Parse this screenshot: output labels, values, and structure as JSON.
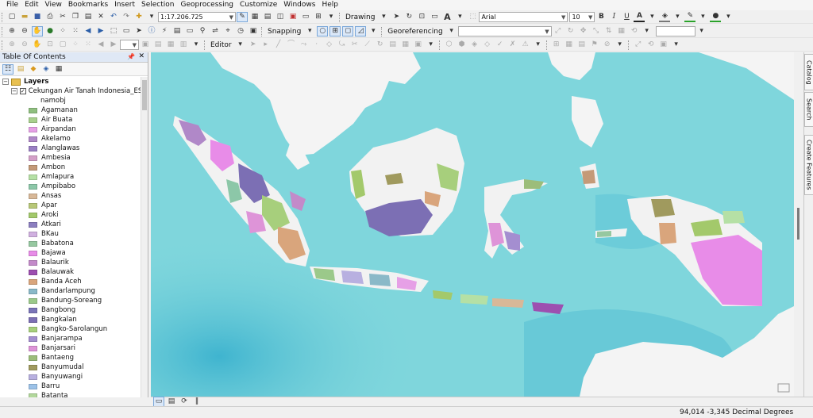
{
  "menubar": {
    "items": [
      "File",
      "Edit",
      "View",
      "Bookmarks",
      "Insert",
      "Selection",
      "Geoprocessing",
      "Customize",
      "Windows",
      "Help"
    ]
  },
  "toolbar": {
    "scale_value": "1:17.206.725",
    "drawing_label": "Drawing",
    "font_name": "Arial",
    "font_size": "10",
    "bold_label": "B",
    "italic_label": "I",
    "underline_label": "U",
    "text_tool_label": "A",
    "snapping_label": "Snapping",
    "georeferencing_label": "Georeferencing",
    "editor_label": "Editor"
  },
  "toc": {
    "title": "Table Of Contents",
    "pin_icon": "pin-icon",
    "close_label": "✕",
    "root_label": "Layers",
    "layer_label": "Cekungan Air Tanah Indonesia_ESDM",
    "field_label": "namobj",
    "legend_items": [
      {
        "label": "Agamanan",
        "color": "#8fbf7f"
      },
      {
        "label": "Air Buata",
        "color": "#a8d08d"
      },
      {
        "label": "Airpandan",
        "color": "#e6a0e6"
      },
      {
        "label": "Akelamo",
        "color": "#b088c8"
      },
      {
        "label": "Alanglawas",
        "color": "#9a7fc4"
      },
      {
        "label": "Ambesia",
        "color": "#d4a0c8"
      },
      {
        "label": "Ambon",
        "color": "#c49a78"
      },
      {
        "label": "Amlapura",
        "color": "#b5e0a5"
      },
      {
        "label": "Ampibabo",
        "color": "#8cc7a8"
      },
      {
        "label": "Ansas",
        "color": "#d8b898"
      },
      {
        "label": "Apar",
        "color": "#b8c878"
      },
      {
        "label": "Aroki",
        "color": "#a3c96b"
      },
      {
        "label": "Atkari",
        "color": "#8c7fc0"
      },
      {
        "label": "BKau",
        "color": "#d0b0e0"
      },
      {
        "label": "Babatona",
        "color": "#96c8a0"
      },
      {
        "label": "Bajawa",
        "color": "#e88ce8"
      },
      {
        "label": "Balaurik",
        "color": "#c38ac9"
      },
      {
        "label": "Balauwak",
        "color": "#9d4fb0"
      },
      {
        "label": "Banda Aceh",
        "color": "#d9a57c"
      },
      {
        "label": "Bandarlampung",
        "color": "#8ab9c8"
      },
      {
        "label": "Bandung-Soreang",
        "color": "#9bc98a"
      },
      {
        "label": "Bangbong",
        "color": "#7a74b8"
      },
      {
        "label": "Bangkalan",
        "color": "#7c6fb4"
      },
      {
        "label": "Bangko-Sarolangun",
        "color": "#a7cf7c"
      },
      {
        "label": "Banjarampa",
        "color": "#a48ed0"
      },
      {
        "label": "Banjarsari",
        "color": "#de94d8"
      },
      {
        "label": "Bantaeng",
        "color": "#9cbd7a"
      },
      {
        "label": "Banyumudal",
        "color": "#a09a5e"
      },
      {
        "label": "Banyuwangi",
        "color": "#b8b0e0"
      },
      {
        "label": "Barru",
        "color": "#9cc2e8"
      },
      {
        "label": "Batanta",
        "color": "#b2d89c"
      }
    ]
  },
  "right_tabs": [
    "Catalog",
    "Search",
    "Create Features"
  ],
  "status": {
    "coordinates": "94,014  -3,345 Decimal Degrees"
  },
  "map": {
    "ocean_color": "#7fd6dc",
    "deep_ocean_color": "#56c0d4",
    "land_color": "#f4f4f4"
  }
}
